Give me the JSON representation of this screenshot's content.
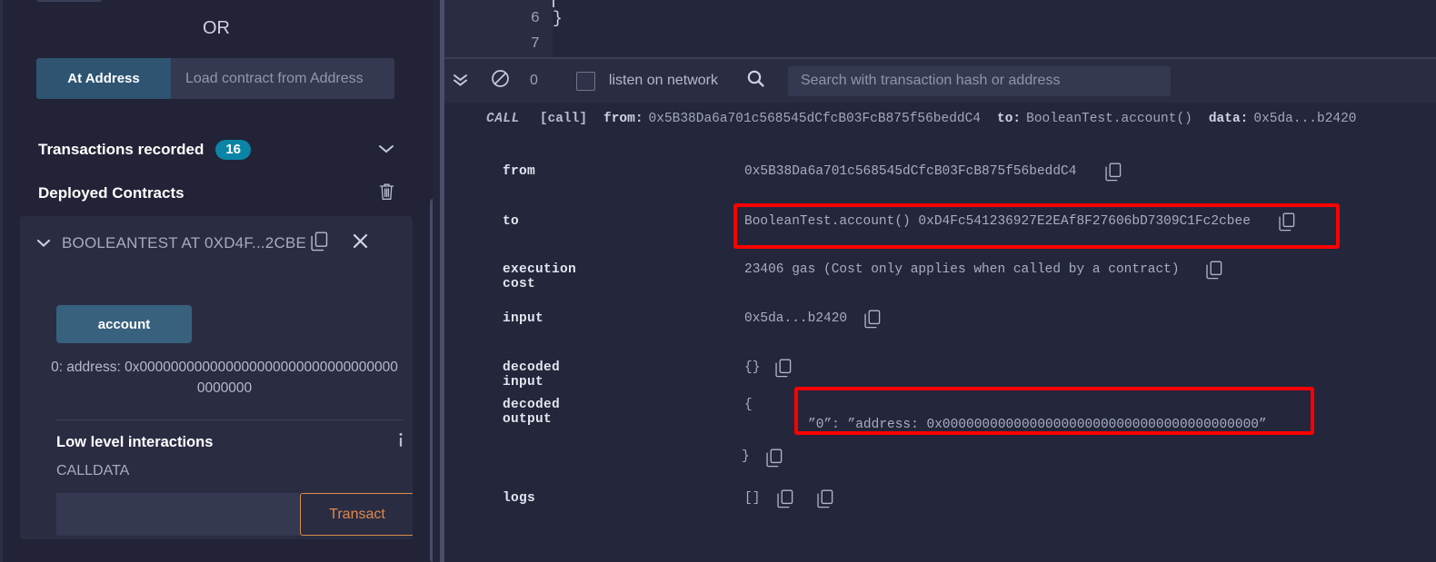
{
  "left_panel": {
    "or_label": "OR",
    "at_address_button": "At Address",
    "at_address_placeholder": "Load contract from Address",
    "at_address_value": "",
    "transactions_recorded_label": "Transactions recorded",
    "transactions_recorded_count": "16",
    "deployed_contracts_label": "Deployed Contracts",
    "contract": {
      "title": "BOOLEANTEST AT 0XD4F...2CBEE (",
      "account_button": "account",
      "account_result": "0:  address: 0x0000000000000000000000000000000000000000"
    },
    "low_level": {
      "title": "Low level interactions",
      "calldata_label": "CALLDATA",
      "calldata_value": "",
      "transact_button": "Transact"
    },
    "icons": {
      "chevron_down": "chevron-down-icon",
      "trash": "trash-icon",
      "copy": "copy-icon",
      "close": "close-icon",
      "info": "info-icon"
    }
  },
  "editor": {
    "line_numbers": [
      "6",
      "7"
    ],
    "line6_text": "}"
  },
  "terminal_toolbar": {
    "error_count": "0",
    "listen_label": "listen on network",
    "listen_checked": false,
    "search_placeholder": "Search with transaction hash or address",
    "search_value": ""
  },
  "terminal": {
    "call_line": {
      "tag": "CALL",
      "bracket": "[call]",
      "from_key": "from:",
      "from_value": "0x5B38Da6a701c568545dCfcB03FcB875f56beddC4",
      "to_key": "to:",
      "to_value": "BooleanTest.account()",
      "data_key": "data:",
      "data_value": "0x5da...b2420"
    },
    "rows": [
      {
        "label": "from",
        "value": "0x5B38Da6a701c568545dCfcB03FcB875f56beddC4"
      },
      {
        "label": "to",
        "value": "BooleanTest.account()  0xD4Fc541236927E2EAf8F27606bD7309C1Fc2cbee"
      },
      {
        "label": "execution cost",
        "value": "23406 gas (Cost only applies when called by a contract)"
      },
      {
        "label": "input",
        "value": "0x5da...b2420"
      },
      {
        "label": "decoded input",
        "value": "{}"
      },
      {
        "label": "decoded output",
        "value": "”0”: ”address: 0x0000000000000000000000000000000000000000”"
      },
      {
        "label": "logs",
        "value": "[]"
      }
    ],
    "decoded_output_open_brace": "{",
    "decoded_output_close_brace": "}",
    "highlight_color": "#ff0000"
  }
}
